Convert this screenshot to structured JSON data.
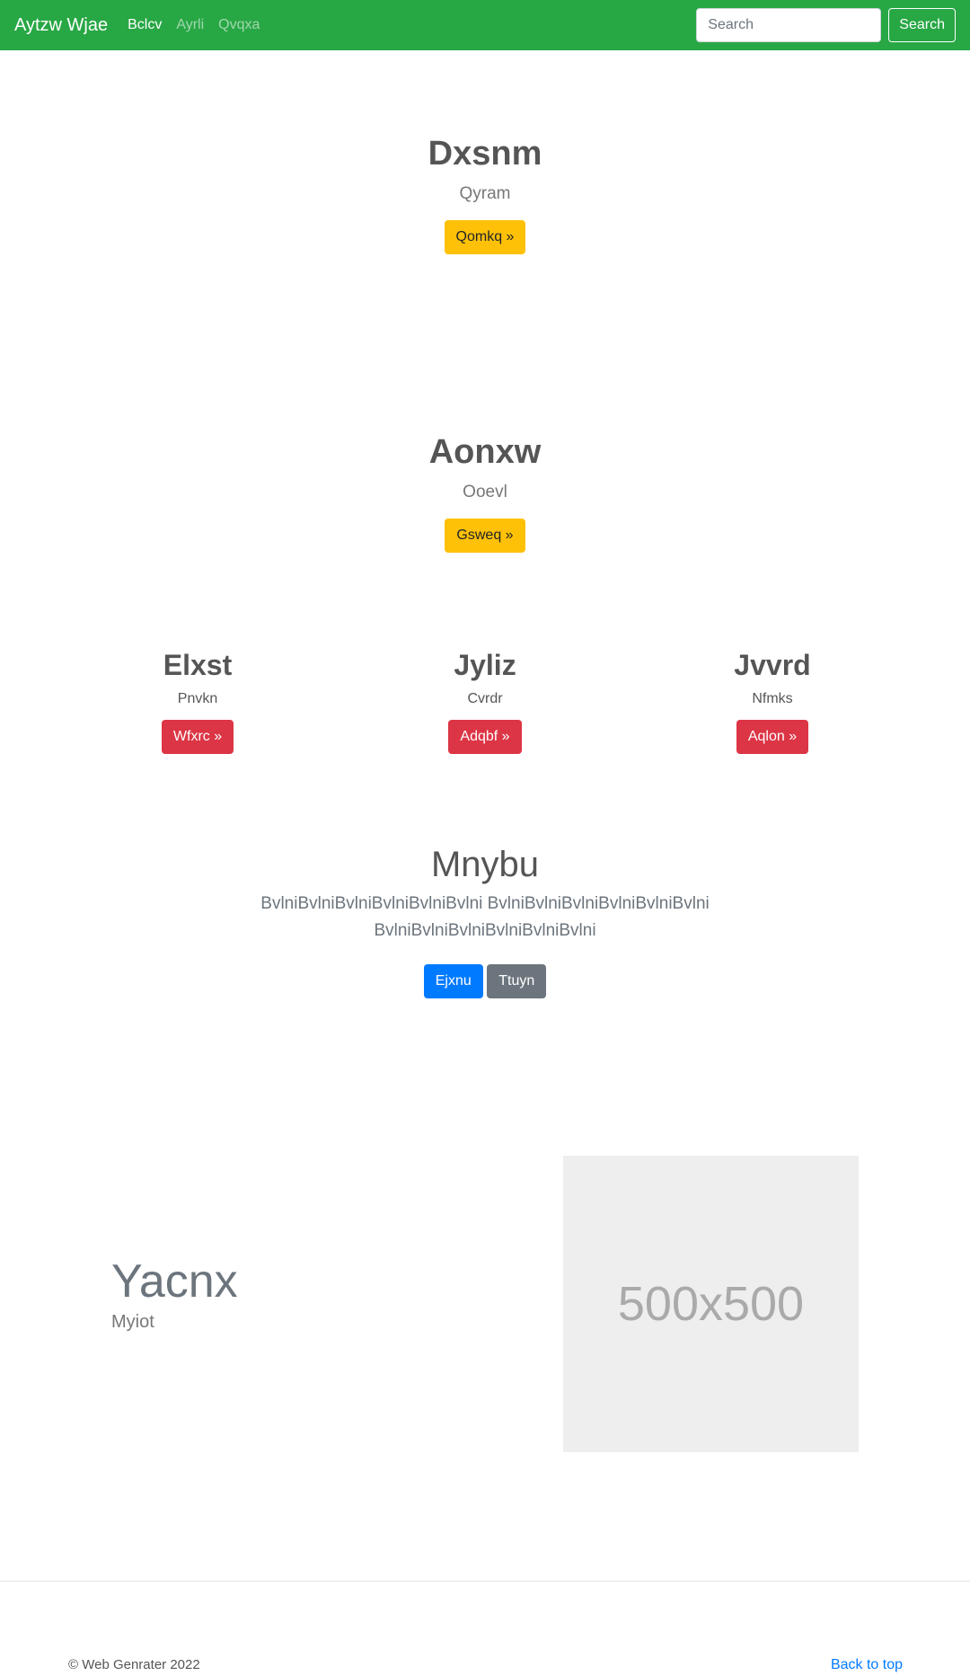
{
  "navbar": {
    "brand": "Aytzw Wjae",
    "links": [
      {
        "label": "Bclcv",
        "active": true
      },
      {
        "label": "Ayrli",
        "active": false
      },
      {
        "label": "Qvqxa",
        "active": false
      }
    ],
    "search_placeholder": "Search",
    "search_button": "Search",
    "color": "#28a745"
  },
  "hero1": {
    "title": "Dxsnm",
    "subtitle": "Qyram",
    "button": "Qomkq »"
  },
  "hero2": {
    "title": "Aonxw",
    "subtitle": "Ooevl",
    "button": "Gsweq »"
  },
  "columns": [
    {
      "title": "Elxst",
      "subtitle": "Pnvkn",
      "button": "Wfxrc »"
    },
    {
      "title": "Jyliz",
      "subtitle": "Cvrdr",
      "button": "Adqbf »"
    },
    {
      "title": "Jvvrd",
      "subtitle": "Nfmks",
      "button": "Aqlon »"
    }
  ],
  "lead": {
    "title": "Mnybu",
    "text": "BvlniBvlniBvlniBvlniBvlniBvlni BvlniBvlniBvlniBvlniBvlniBvlni BvlniBvlniBvlniBvlniBvlniBvlni",
    "primary_button": "Ejxnu",
    "secondary_button": "Ttuyn"
  },
  "feature": {
    "title": "Yacnx",
    "subtitle": "Myiot",
    "image_label": "500x500"
  },
  "footer": {
    "copyright": "© Web Genrater 2022",
    "back_to_top": "Back to top"
  }
}
